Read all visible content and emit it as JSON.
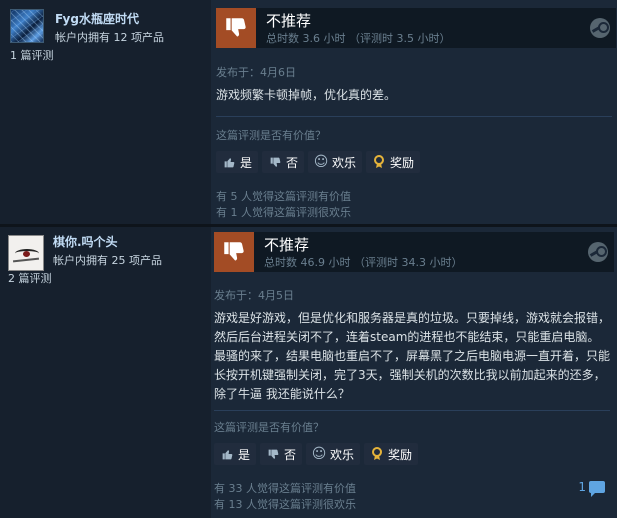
{
  "reviews": [
    {
      "author": "Fyg水瓶座时代",
      "products_owned": "帐户内拥有 12 项产品",
      "review_count": "1 篇评测",
      "verdict": "不推荐",
      "hours": "总时数 3.6 小时 （评测时 3.5 小时）",
      "posted": "发布于：4月6日",
      "body": "游戏频繁卡顿掉帧，优化真的差。",
      "helpful_question": "这篇评测是否有价值？",
      "buttons": {
        "yes": "是",
        "no": "否",
        "funny": "欢乐",
        "award": "奖励"
      },
      "helpful_count": "有 5 人觉得这篇评测有价值",
      "funny_count": "有 1 人觉得这篇评测很欢乐"
    },
    {
      "author": "棋你.吗个头",
      "products_owned": "帐户内拥有 25 项产品",
      "review_count": "2 篇评测",
      "verdict": "不推荐",
      "hours": "总时数 46.9 小时 （评测时 34.3 小时）",
      "posted": "发布于：4月5日",
      "body": "游戏是好游戏，但是优化和服务器是真的垃圾。只要掉线，游戏就会报错，然后后台进程关闭不了，连着steam的进程也不能结束，只能重启电脑。最骚的来了，结果电脑也重启不了，屏幕黑了之后电脑电源一直开着，只能长按开机键强制关闭，完了3天，强制关机的次数比我以前加起来的还多，除了牛逼 我还能说什么？",
      "helpful_question": "这篇评测是否有价值？",
      "buttons": {
        "yes": "是",
        "no": "否",
        "funny": "欢乐",
        "award": "奖励"
      },
      "helpful_count": "有 33 人觉得这篇评测有价值",
      "funny_count": "有 13 人觉得这篇评测很欢乐",
      "comment_count": "1"
    }
  ],
  "icons": {
    "thumbs_down": "thumbs-down-icon",
    "steam": "steam-icon",
    "comment": "comment-icon"
  },
  "colors": {
    "background": "#1b2838",
    "verdict_box": "#a34c25",
    "award": "#e5b33a",
    "link": "#5fa5e2"
  }
}
